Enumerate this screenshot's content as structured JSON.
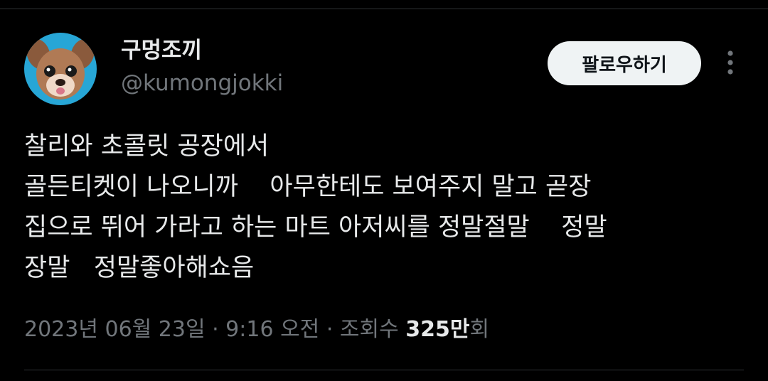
{
  "user": {
    "display_name": "구멍조끼",
    "handle": "@kumongjokki",
    "avatar_icon": "chihuahua-avatar"
  },
  "follow_label": "팔로우하기",
  "more_icon": "more-vertical-icon",
  "tweet": {
    "text": "찰리와 초콜릿 공장에서\n골든티켓이 나오니까    아무한테도 보여주지 말고 곧장\n집으로 뛰어 가라고 하는 마트 아저씨를 정말절말    정말\n장말   정말좋아해쇼음"
  },
  "meta": {
    "timestamp": "2023년 06월 23일 · 9:16 오전",
    "separator": " · ",
    "views_prefix": "조회수 ",
    "views_count": "325만",
    "views_suffix": "회"
  },
  "colors": {
    "background": "#000000",
    "primary_text": "#e7e9ea",
    "secondary_text": "#71767b",
    "follow_button_bg": "#eff3f4",
    "divider": "#2f3336"
  }
}
